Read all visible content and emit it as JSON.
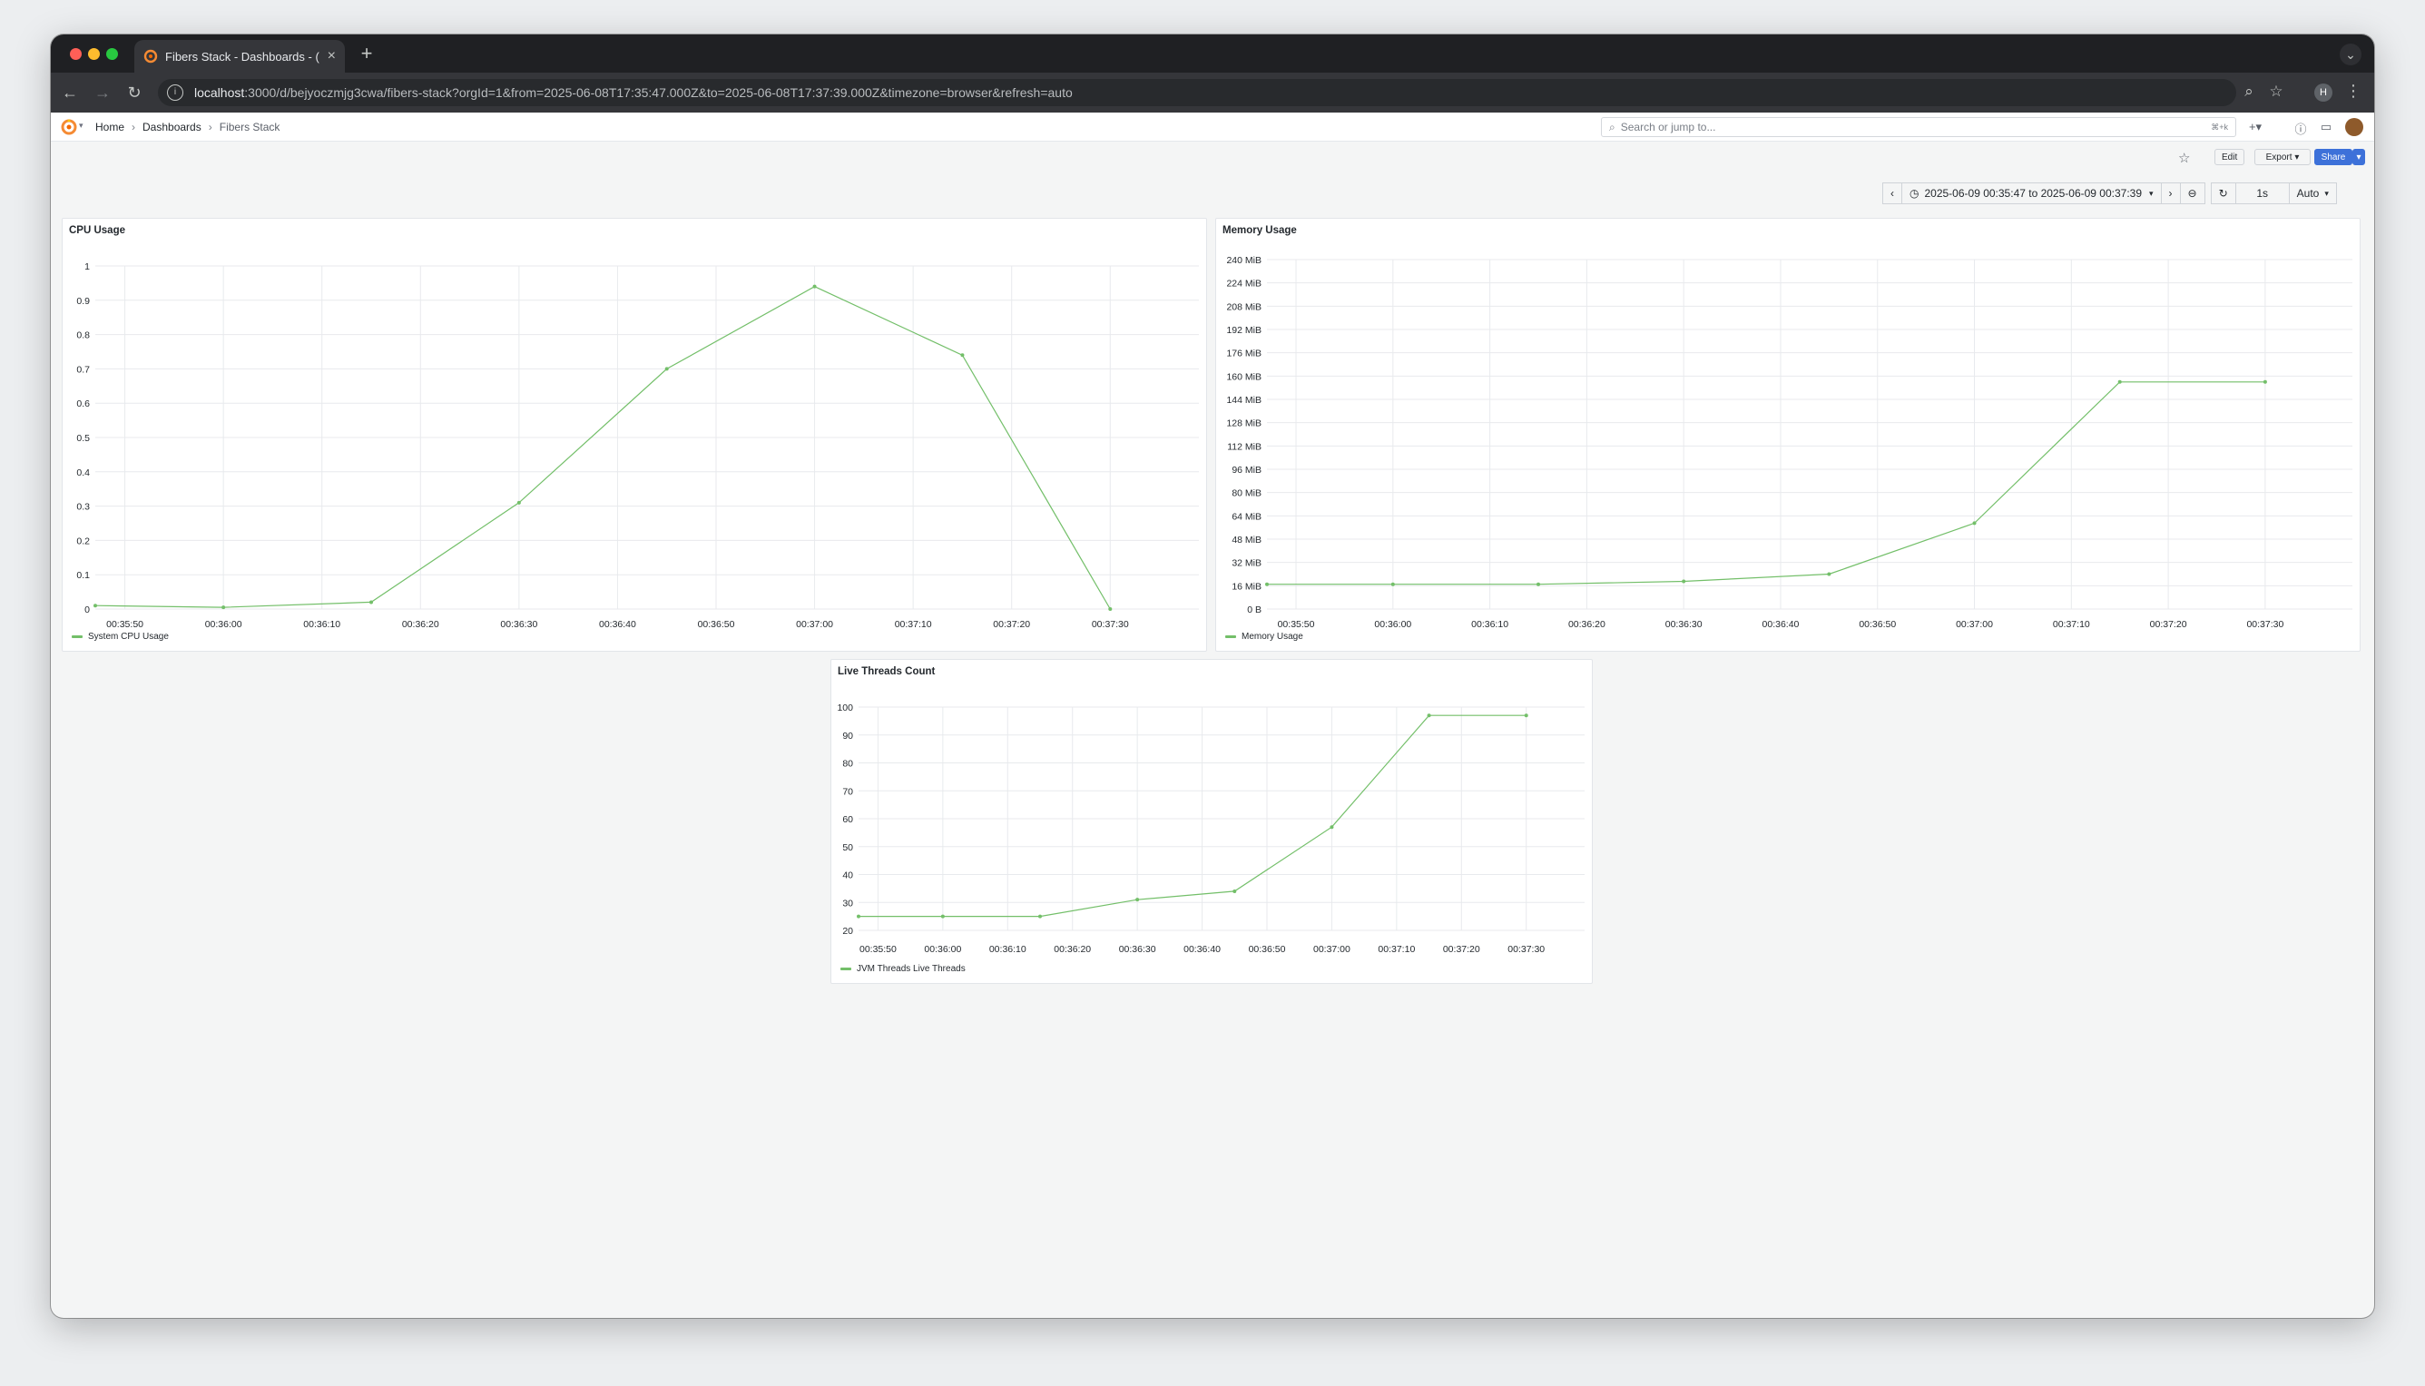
{
  "browser": {
    "tab_title": "Fibers Stack - Dashboards - (",
    "url_host": "localhost",
    "url_rest": ":3000/d/bejyoczmjg3cwa/fibers-stack?orgId=1&from=2025-06-08T17:35:47.000Z&to=2025-06-08T17:37:39.000Z&timezone=browser&refresh=auto",
    "profile_initial": "H"
  },
  "grafana": {
    "breadcrumb": [
      "Home",
      "Dashboards",
      "Fibers Stack"
    ],
    "search_placeholder": "Search or jump to...",
    "search_shortcut": "⌘+k",
    "buttons": {
      "edit": "Edit",
      "export": "Export",
      "share": "Share"
    },
    "time_range": "2025-06-09 00:35:47 to 2025-06-09 00:37:39",
    "refresh_interval": "1s",
    "auto_label": "Auto"
  },
  "chart_data": [
    {
      "id": "cpu",
      "type": "line",
      "title": "CPU Usage",
      "color": "#73bf69",
      "x_ticks": [
        "00:35:50",
        "00:36:00",
        "00:36:10",
        "00:36:20",
        "00:36:30",
        "00:36:40",
        "00:36:50",
        "00:37:00",
        "00:37:10",
        "00:37:20",
        "00:37:30"
      ],
      "y_ticks": [
        "0",
        "0.1",
        "0.2",
        "0.3",
        "0.4",
        "0.5",
        "0.6",
        "0.7",
        "0.8",
        "0.9",
        "1"
      ],
      "ylim": [
        0,
        1
      ],
      "series": [
        {
          "name": "System CPU Usage",
          "x": [
            "00:35:47",
            "00:36:00",
            "00:36:15",
            "00:36:30",
            "00:36:45",
            "00:37:00",
            "00:37:15",
            "00:37:30"
          ],
          "values": [
            0.01,
            0.005,
            0.02,
            0.31,
            0.7,
            0.94,
            0.74,
            0.0
          ]
        }
      ]
    },
    {
      "id": "mem",
      "type": "line",
      "title": "Memory Usage",
      "color": "#73bf69",
      "x_ticks": [
        "00:35:50",
        "00:36:00",
        "00:36:10",
        "00:36:20",
        "00:36:30",
        "00:36:40",
        "00:36:50",
        "00:37:00",
        "00:37:10",
        "00:37:20",
        "00:37:30"
      ],
      "y_ticks": [
        "0 B",
        "16 MiB",
        "32 MiB",
        "48 MiB",
        "64 MiB",
        "80 MiB",
        "96 MiB",
        "112 MiB",
        "128 MiB",
        "144 MiB",
        "160 MiB",
        "176 MiB",
        "192 MiB",
        "208 MiB",
        "224 MiB",
        "240 MiB"
      ],
      "ylim": [
        0,
        240
      ],
      "series": [
        {
          "name": "Memory Usage",
          "x": [
            "00:35:47",
            "00:36:00",
            "00:36:15",
            "00:36:30",
            "00:36:45",
            "00:37:00",
            "00:37:15",
            "00:37:30"
          ],
          "values": [
            17,
            17,
            17,
            19,
            24,
            59,
            156,
            156
          ]
        }
      ]
    },
    {
      "id": "threads",
      "type": "line",
      "title": "Live Threads Count",
      "color": "#73bf69",
      "x_ticks": [
        "00:35:50",
        "00:36:00",
        "00:36:10",
        "00:36:20",
        "00:36:30",
        "00:36:40",
        "00:36:50",
        "00:37:00",
        "00:37:10",
        "00:37:20",
        "00:37:30"
      ],
      "y_ticks": [
        "20",
        "30",
        "40",
        "50",
        "60",
        "70",
        "80",
        "90",
        "100"
      ],
      "ylim": [
        20,
        100
      ],
      "series": [
        {
          "name": "JVM Threads Live Threads",
          "x": [
            "00:35:47",
            "00:36:00",
            "00:36:15",
            "00:36:30",
            "00:36:45",
            "00:37:00",
            "00:37:15",
            "00:37:30"
          ],
          "values": [
            25,
            25,
            25,
            31,
            34,
            57,
            97,
            97
          ]
        }
      ]
    }
  ]
}
